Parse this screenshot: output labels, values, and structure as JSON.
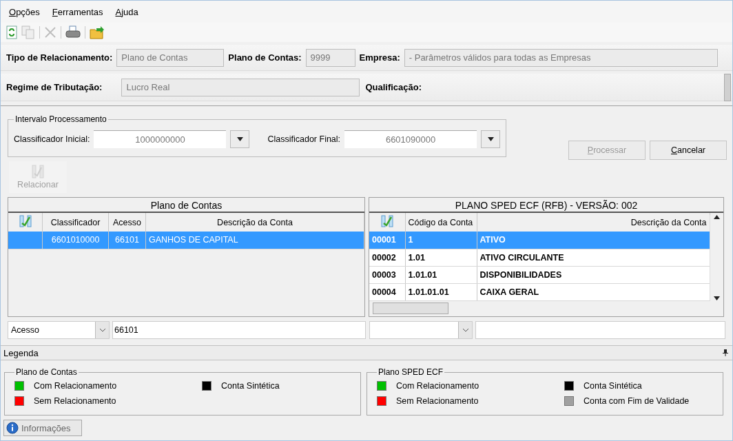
{
  "menu": [
    {
      "label": "Opções"
    },
    {
      "label": "Ferramentas"
    },
    {
      "label": "Ajuda"
    }
  ],
  "toolbar": [
    {
      "kind": "refresh",
      "disabled": false
    },
    {
      "kind": "copy",
      "disabled": true
    },
    {
      "kind": "separator"
    },
    {
      "kind": "delete",
      "disabled": true
    },
    {
      "kind": "separator"
    },
    {
      "kind": "print",
      "disabled": false
    },
    {
      "kind": "separator"
    },
    {
      "kind": "open",
      "disabled": false
    }
  ],
  "header": {
    "row_1": [
      {
        "label": "Tipo de Relacionamento:",
        "value": "Plano de Contas"
      },
      {
        "label": "Plano de Contas:",
        "value": "9999"
      },
      {
        "label": "Empresa:",
        "value": "- Parâmetros válidos para todas as Empresas"
      }
    ],
    "row_2": [
      {
        "label": "Regime de Tributação:",
        "value": "Lucro Real"
      },
      {
        "label": "Qualificação:"
      }
    ]
  },
  "interval": {
    "title": "Intervalo Processamento",
    "fields": [
      {
        "label": "Classificador Inicial:",
        "value": "1000000000"
      },
      {
        "label": "Classificador Final:",
        "value": "6601090000"
      }
    ]
  },
  "buttons": [
    {
      "label": "Processar",
      "disabled": true
    },
    {
      "label": "Cancelar",
      "disabled": false
    }
  ],
  "relate_button": {
    "label": "Relacionar",
    "disabled": true
  },
  "left_grid": {
    "title": "Plano de Contas",
    "columns": [
      "",
      "Classificador",
      "Acesso",
      "Descrição da Conta"
    ],
    "rows": [
      {
        "cells": [
          "",
          "6601010000",
          "66101",
          "GANHOS DE CAPITAL"
        ],
        "selected": true
      }
    ]
  },
  "right_grid": {
    "title": "PLANO SPED ECF (RFB) - VERSÃO: 002",
    "columns": [
      "",
      "Código da Conta",
      "Descrição da Conta"
    ],
    "rows": [
      {
        "cells": [
          "00001",
          "1",
          "ATIVO"
        ],
        "selected": true
      },
      {
        "cells": [
          "00002",
          "1.01",
          "ATIVO CIRCULANTE"
        ],
        "selected": false
      },
      {
        "cells": [
          "00003",
          "1.01.01",
          "DISPONIBILIDADES"
        ],
        "selected": false
      },
      {
        "cells": [
          "00004",
          "1.01.01.01",
          "CAIXA GERAL"
        ],
        "selected": false
      }
    ]
  },
  "left_filter": {
    "field": "Acesso",
    "value": "66101"
  },
  "legend": {
    "title": "Legenda",
    "groups": [
      {
        "title": "Plano de Contas",
        "items": [
          {
            "label": "Com Relacionamento",
            "color": "#00c000"
          },
          {
            "label": "Sem Relacionamento",
            "color": "#ff0000"
          },
          {
            "label": "Conta Sintética",
            "color": "#000000"
          }
        ]
      },
      {
        "title": "Plano SPED ECF",
        "items": [
          {
            "label": "Com Relacionamento",
            "color": "#00c000"
          },
          {
            "label": "Sem Relacionamento",
            "color": "#ff0000"
          },
          {
            "label": "Conta Sintética",
            "color": "#000000"
          },
          {
            "label": "Conta com Fim de Validade",
            "color": "#a0a0a0"
          }
        ]
      }
    ]
  },
  "bottom_tab": {
    "label": "Informações"
  }
}
